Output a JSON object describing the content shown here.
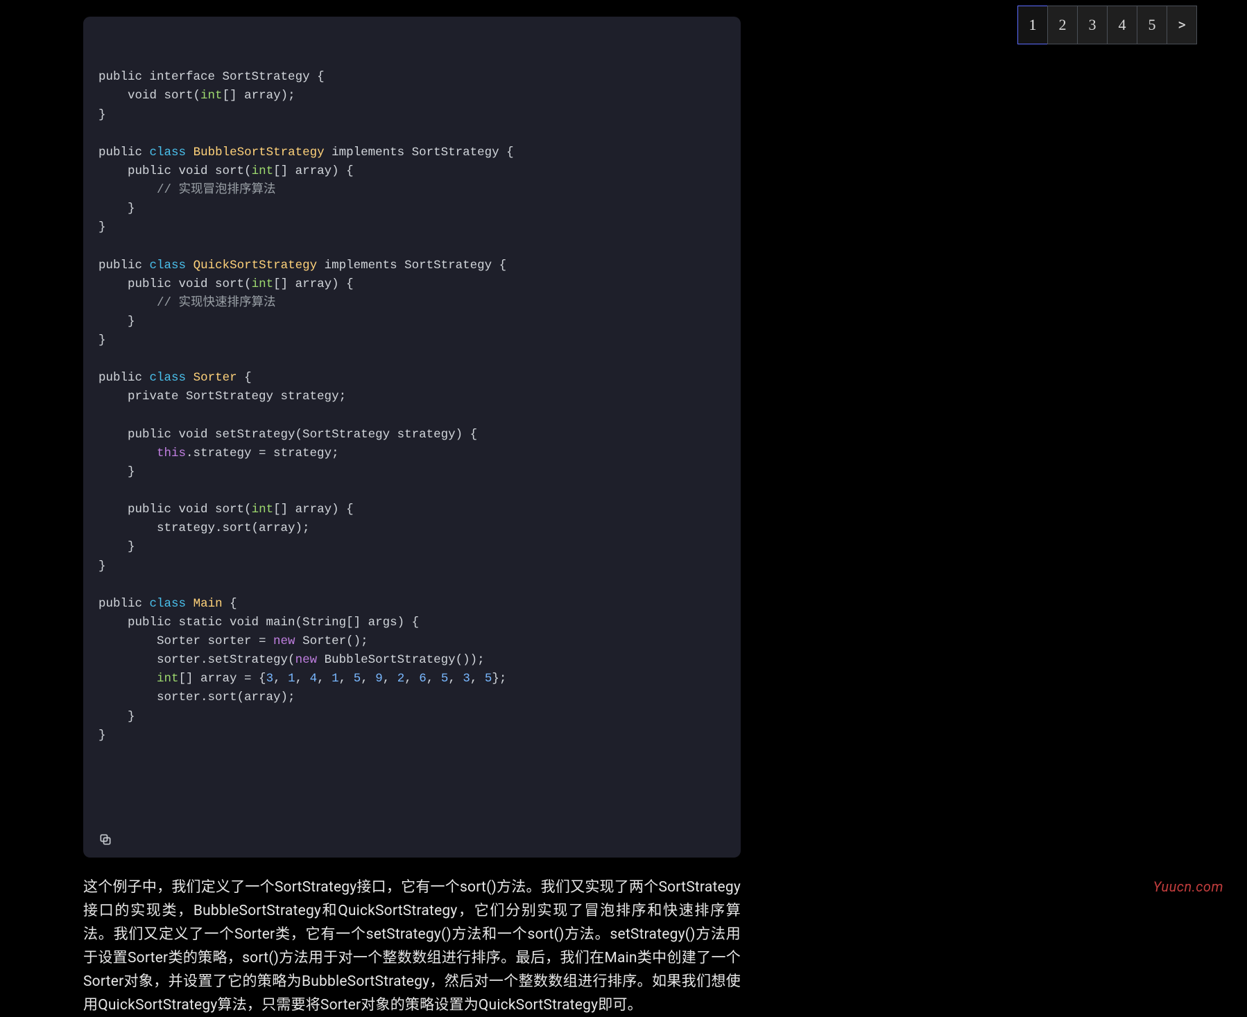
{
  "code": {
    "lines": [
      {
        "kind": "plain",
        "indent": 0,
        "tokens": [
          [
            "public",
            "k-public"
          ],
          [
            " interface ",
            "plain"
          ],
          [
            "SortStrategy {",
            "plain"
          ]
        ]
      },
      {
        "kind": "plain",
        "indent": 1,
        "tokens": [
          [
            "void",
            "plain"
          ],
          [
            " sort(",
            "plain"
          ],
          [
            "int",
            "k-int"
          ],
          [
            "[] array);",
            "plain"
          ]
        ]
      },
      {
        "kind": "plain",
        "indent": 0,
        "tokens": [
          [
            "}",
            "plain"
          ]
        ]
      },
      {
        "kind": "blank"
      },
      {
        "kind": "plain",
        "indent": 0,
        "tokens": [
          [
            "public",
            "k-public"
          ],
          [
            " ",
            "plain"
          ],
          [
            "class",
            "k-class"
          ],
          [
            " ",
            "plain"
          ],
          [
            "BubbleSortStrategy",
            "cname"
          ],
          [
            " ",
            "plain"
          ],
          [
            "implements",
            "plain"
          ],
          [
            " SortStrategy {",
            "plain"
          ]
        ]
      },
      {
        "kind": "plain",
        "indent": 1,
        "tokens": [
          [
            "public",
            "k-public"
          ],
          [
            " void sort(",
            "plain"
          ],
          [
            "int",
            "k-int"
          ],
          [
            "[] array) {",
            "plain"
          ]
        ]
      },
      {
        "kind": "plain",
        "indent": 2,
        "tokens": [
          [
            "// 实现冒泡排序算法",
            "comment"
          ]
        ]
      },
      {
        "kind": "plain",
        "indent": 1,
        "tokens": [
          [
            "}",
            "plain"
          ]
        ]
      },
      {
        "kind": "plain",
        "indent": 0,
        "tokens": [
          [
            "}",
            "plain"
          ]
        ]
      },
      {
        "kind": "blank"
      },
      {
        "kind": "plain",
        "indent": 0,
        "tokens": [
          [
            "public",
            "k-public"
          ],
          [
            " ",
            "plain"
          ],
          [
            "class",
            "k-class"
          ],
          [
            " ",
            "plain"
          ],
          [
            "QuickSortStrategy",
            "cname"
          ],
          [
            " ",
            "plain"
          ],
          [
            "implements",
            "plain"
          ],
          [
            " SortStrategy {",
            "plain"
          ]
        ]
      },
      {
        "kind": "plain",
        "indent": 1,
        "tokens": [
          [
            "public",
            "k-public"
          ],
          [
            " void sort(",
            "plain"
          ],
          [
            "int",
            "k-int"
          ],
          [
            "[] array) {",
            "plain"
          ]
        ]
      },
      {
        "kind": "plain",
        "indent": 2,
        "tokens": [
          [
            "// 实现快速排序算法",
            "comment"
          ]
        ]
      },
      {
        "kind": "plain",
        "indent": 1,
        "tokens": [
          [
            "}",
            "plain"
          ]
        ]
      },
      {
        "kind": "plain",
        "indent": 0,
        "tokens": [
          [
            "}",
            "plain"
          ]
        ]
      },
      {
        "kind": "blank"
      },
      {
        "kind": "plain",
        "indent": 0,
        "tokens": [
          [
            "public",
            "k-public"
          ],
          [
            " ",
            "plain"
          ],
          [
            "class",
            "k-class"
          ],
          [
            " ",
            "plain"
          ],
          [
            "Sorter",
            "cname"
          ],
          [
            " {",
            "plain"
          ]
        ]
      },
      {
        "kind": "plain",
        "indent": 1,
        "tokens": [
          [
            "private SortStrategy strategy;",
            "plain"
          ]
        ]
      },
      {
        "kind": "blank"
      },
      {
        "kind": "plain",
        "indent": 1,
        "tokens": [
          [
            "public",
            "k-public"
          ],
          [
            " void setStrategy(SortStrategy strategy) {",
            "plain"
          ]
        ]
      },
      {
        "kind": "plain",
        "indent": 2,
        "tokens": [
          [
            "this",
            "k-this"
          ],
          [
            ".strategy = strategy;",
            "plain"
          ]
        ]
      },
      {
        "kind": "plain",
        "indent": 1,
        "tokens": [
          [
            "}",
            "plain"
          ]
        ]
      },
      {
        "kind": "blank"
      },
      {
        "kind": "plain",
        "indent": 1,
        "tokens": [
          [
            "public",
            "k-public"
          ],
          [
            " void sort(",
            "plain"
          ],
          [
            "int",
            "k-int"
          ],
          [
            "[] array) {",
            "plain"
          ]
        ]
      },
      {
        "kind": "plain",
        "indent": 2,
        "tokens": [
          [
            "strategy.sort(array);",
            "plain"
          ]
        ]
      },
      {
        "kind": "plain",
        "indent": 1,
        "tokens": [
          [
            "}",
            "plain"
          ]
        ]
      },
      {
        "kind": "plain",
        "indent": 0,
        "tokens": [
          [
            "}",
            "plain"
          ]
        ]
      },
      {
        "kind": "blank"
      },
      {
        "kind": "plain",
        "indent": 0,
        "tokens": [
          [
            "public",
            "k-public"
          ],
          [
            " ",
            "plain"
          ],
          [
            "class",
            "k-class"
          ],
          [
            " ",
            "plain"
          ],
          [
            "Main",
            "cname"
          ],
          [
            " {",
            "plain"
          ]
        ]
      },
      {
        "kind": "plain",
        "indent": 1,
        "tokens": [
          [
            "public",
            "k-public"
          ],
          [
            " static void main(String[] args) {",
            "plain"
          ]
        ]
      },
      {
        "kind": "plain",
        "indent": 2,
        "tokens": [
          [
            "Sorter sorter = ",
            "plain"
          ],
          [
            "new",
            "k-new"
          ],
          [
            " Sorter();",
            "plain"
          ]
        ]
      },
      {
        "kind": "plain",
        "indent": 2,
        "tokens": [
          [
            "sorter.setStrategy(",
            "plain"
          ],
          [
            "new",
            "k-new"
          ],
          [
            " BubbleSortStrategy());",
            "plain"
          ]
        ]
      },
      {
        "kind": "plain",
        "indent": 2,
        "tokens": [
          [
            "int",
            "k-int"
          ],
          [
            "[] array = {",
            "plain"
          ],
          [
            "3",
            "num"
          ],
          [
            ", ",
            "plain"
          ],
          [
            "1",
            "num"
          ],
          [
            ", ",
            "plain"
          ],
          [
            "4",
            "num"
          ],
          [
            ", ",
            "plain"
          ],
          [
            "1",
            "num"
          ],
          [
            ", ",
            "plain"
          ],
          [
            "5",
            "num"
          ],
          [
            ", ",
            "plain"
          ],
          [
            "9",
            "num"
          ],
          [
            ", ",
            "plain"
          ],
          [
            "2",
            "num"
          ],
          [
            ", ",
            "plain"
          ],
          [
            "6",
            "num"
          ],
          [
            ", ",
            "plain"
          ],
          [
            "5",
            "num"
          ],
          [
            ", ",
            "plain"
          ],
          [
            "3",
            "num"
          ],
          [
            ", ",
            "plain"
          ],
          [
            "5",
            "num"
          ],
          [
            "};",
            "plain"
          ]
        ]
      },
      {
        "kind": "plain",
        "indent": 2,
        "tokens": [
          [
            "sorter.sort(array);",
            "plain"
          ]
        ]
      },
      {
        "kind": "plain",
        "indent": 1,
        "tokens": [
          [
            "}",
            "plain"
          ]
        ]
      },
      {
        "kind": "plain",
        "indent": 0,
        "tokens": [
          [
            "}",
            "plain"
          ]
        ]
      }
    ],
    "indent_unit": "    "
  },
  "body_text": "这个例子中，我们定义了一个SortStrategy接口，它有一个sort()方法。我们又实现了两个SortStrategy接口的实现类，BubbleSortStrategy和QuickSortStrategy，它们分别实现了冒泡排序和快速排序算法。我们又定义了一个Sorter类，它有一个setStrategy()方法和一个sort()方法。setStrategy()方法用于设置Sorter类的策略，sort()方法用于对一个整数数组进行排序。最后，我们在Main类中创建了一个Sorter对象，并设置了它的策略为BubbleSortStrategy，然后对一个整数数组进行排序。如果我们想使用QuickSortStrategy算法，只需要将Sorter对象的策略设置为QuickSortStrategy即可。",
  "pager": {
    "items": [
      "1",
      "2",
      "3",
      "4",
      "5",
      ">"
    ],
    "active_index": 0
  },
  "watermark": "Yuucn.com"
}
